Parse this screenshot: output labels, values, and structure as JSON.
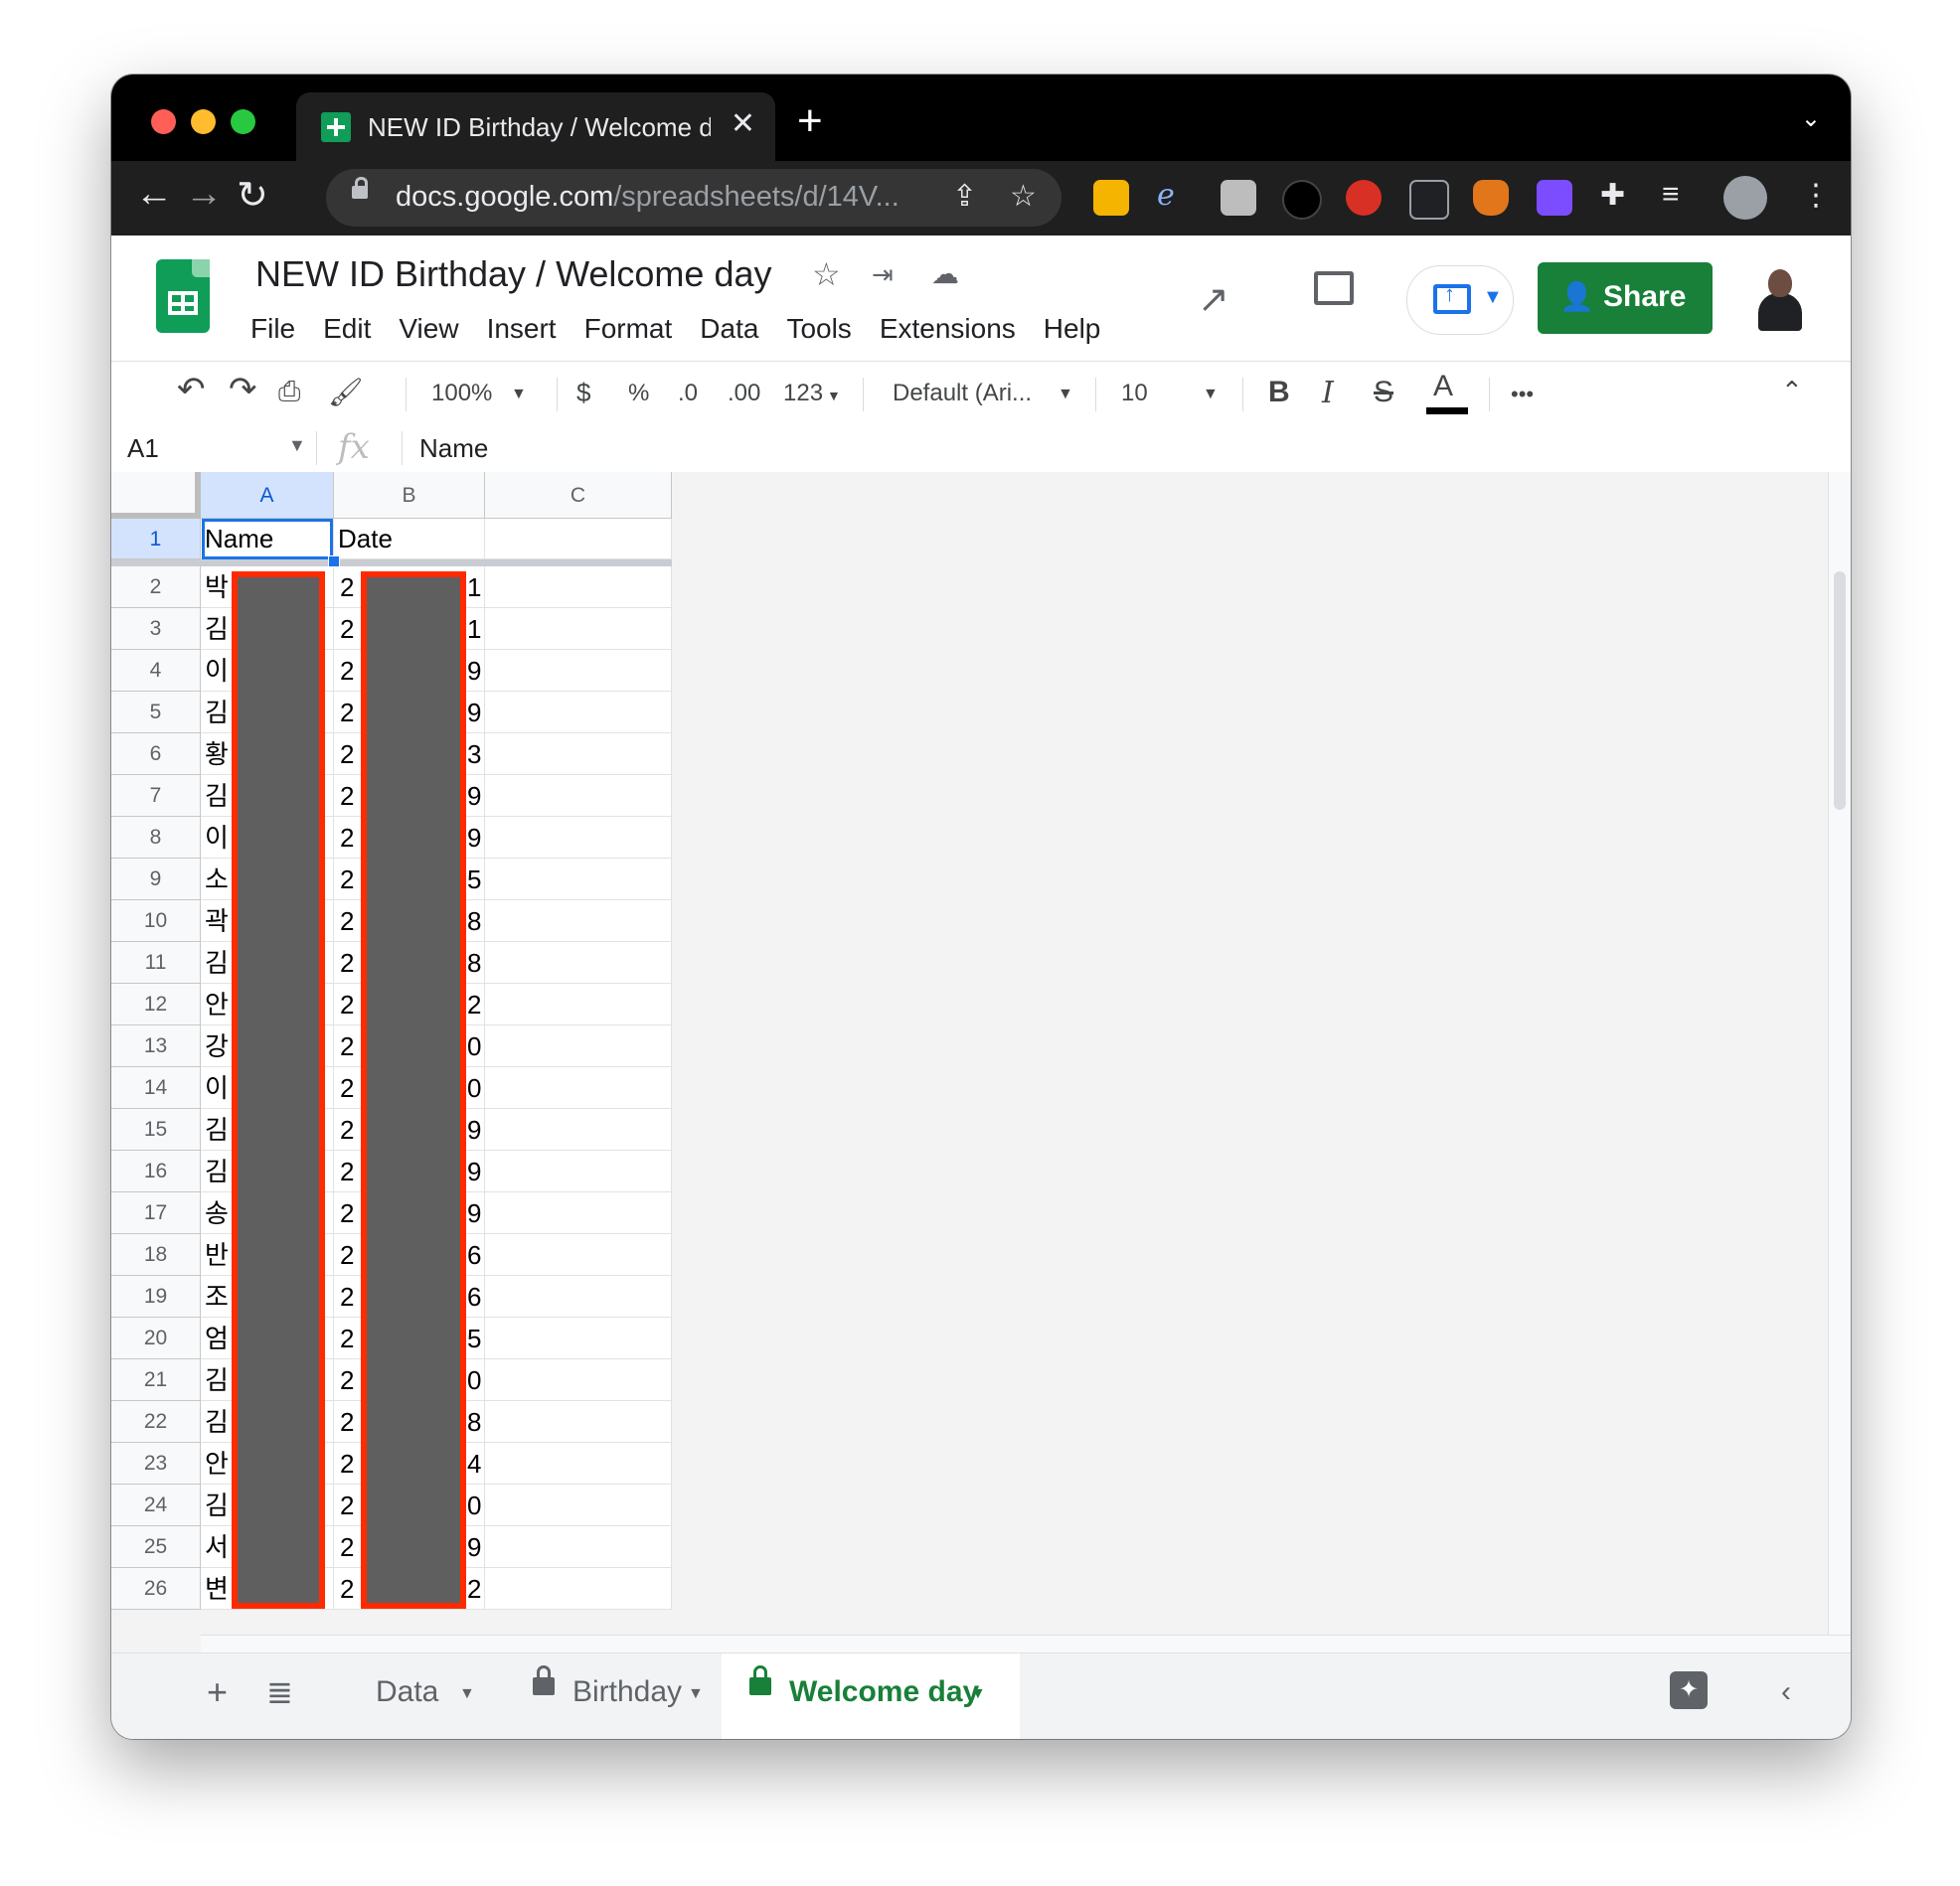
{
  "browser": {
    "tab_title": "NEW ID Birthday / Welcome da",
    "close_glyph": "✕",
    "new_tab_glyph": "+",
    "url_host": "docs.google.com",
    "url_path": "/spreadsheets/d/14V..."
  },
  "doc": {
    "title": "NEW ID Birthday / Welcome day",
    "menu": [
      "File",
      "Edit",
      "View",
      "Insert",
      "Format",
      "Data",
      "Tools",
      "Extensions",
      "Help"
    ],
    "share_label": "Share"
  },
  "toolbar": {
    "zoom": "100%",
    "currency": "$",
    "percent": "%",
    "dec_decrease": ".0",
    "dec_increase": ".00",
    "more_formats": "123",
    "font": "Default (Ari...",
    "font_size": "10",
    "bold": "B",
    "italic": "I",
    "strike": "S",
    "text_color": "A",
    "more": "•••"
  },
  "formula_bar": {
    "cell_ref": "A1",
    "fx": "fx",
    "content": "Name"
  },
  "grid": {
    "columns": [
      "A",
      "B",
      "C"
    ],
    "header_row": {
      "num": "1",
      "a": "Name",
      "b": "Date"
    },
    "rows": [
      {
        "num": "2",
        "a": "박",
        "b1": "2",
        "b2": "1"
      },
      {
        "num": "3",
        "a": "김",
        "b1": "2",
        "b2": "1"
      },
      {
        "num": "4",
        "a": "이",
        "b1": "2",
        "b2": "9"
      },
      {
        "num": "5",
        "a": "김",
        "b1": "2",
        "b2": "9"
      },
      {
        "num": "6",
        "a": "황",
        "b1": "2",
        "b2": "3"
      },
      {
        "num": "7",
        "a": "김",
        "b1": "2",
        "b2": "9"
      },
      {
        "num": "8",
        "a": "이",
        "b1": "2",
        "b2": "9"
      },
      {
        "num": "9",
        "a": "소",
        "b1": "2",
        "b2": "5"
      },
      {
        "num": "10",
        "a": "곽",
        "b1": "2",
        "b2": "8"
      },
      {
        "num": "11",
        "a": "김",
        "b1": "2",
        "b2": "8"
      },
      {
        "num": "12",
        "a": "안",
        "b1": "2",
        "b2": "2"
      },
      {
        "num": "13",
        "a": "강",
        "b1": "2",
        "b2": "0"
      },
      {
        "num": "14",
        "a": "이",
        "b1": "2",
        "b2": "0"
      },
      {
        "num": "15",
        "a": "김",
        "b1": "2",
        "b2": "9"
      },
      {
        "num": "16",
        "a": "김",
        "b1": "2",
        "b2": "9"
      },
      {
        "num": "17",
        "a": "송",
        "b1": "2",
        "b2": "9"
      },
      {
        "num": "18",
        "a": "반",
        "b1": "2",
        "b2": "6"
      },
      {
        "num": "19",
        "a": "조",
        "b1": "2",
        "b2": "6"
      },
      {
        "num": "20",
        "a": "엄",
        "b1": "2",
        "b2": "5"
      },
      {
        "num": "21",
        "a": "김",
        "b1": "2",
        "b2": "0"
      },
      {
        "num": "22",
        "a": "김",
        "b1": "2",
        "b2": "8"
      },
      {
        "num": "23",
        "a": "안",
        "b1": "2",
        "b2": "4"
      },
      {
        "num": "24",
        "a": "김",
        "b1": "2",
        "b2": "0"
      },
      {
        "num": "25",
        "a": "서",
        "b1": "2",
        "b2": "9"
      },
      {
        "num": "26",
        "a": "변",
        "b1": "2",
        "b2": "2"
      }
    ]
  },
  "sheets": {
    "tabs": [
      "Data",
      "Birthday",
      "Welcome day"
    ],
    "active": "Welcome day"
  },
  "colors": {
    "sheets_green": "#188038",
    "selection_blue": "#1a73e8",
    "redaction_border": "#ff2a00",
    "redaction_fill": "#5f5f5f"
  }
}
